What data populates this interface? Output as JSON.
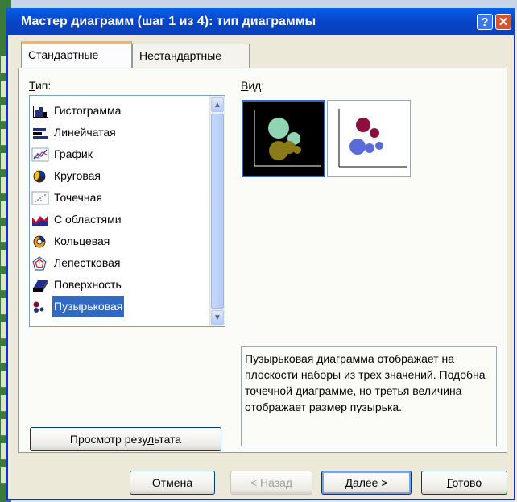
{
  "window": {
    "title": "Мастер диаграмм (шаг 1 из 4): тип диаграммы",
    "help_label": "?",
    "close_label": "✕"
  },
  "tabs": [
    {
      "label": "Стандартные",
      "active": true
    },
    {
      "label": "Нестандартные",
      "active": false
    }
  ],
  "type_label_first": "Т",
  "type_label_rest": "ип:",
  "view_label_first": "В",
  "view_label_rest": "ид:",
  "chart_types": [
    {
      "label": "Гистограмма",
      "icon": "column-chart-icon"
    },
    {
      "label": "Линейчатая",
      "icon": "bar-chart-icon"
    },
    {
      "label": "График",
      "icon": "line-chart-icon"
    },
    {
      "label": "Круговая",
      "icon": "pie-chart-icon"
    },
    {
      "label": "Точечная",
      "icon": "scatter-chart-icon"
    },
    {
      "label": "С областями",
      "icon": "area-chart-icon"
    },
    {
      "label": "Кольцевая",
      "icon": "doughnut-chart-icon"
    },
    {
      "label": "Лепестковая",
      "icon": "radar-chart-icon"
    },
    {
      "label": "Поверхность",
      "icon": "surface-chart-icon"
    },
    {
      "label": "Пузырьковая",
      "icon": "bubble-chart-icon",
      "selected": true
    }
  ],
  "description": "Пузырьковая диаграмма отображает на плоскости наборы из трех значений. Подобна точечной диаграмме, но третья величина отображает размер пузырька.",
  "buttons": {
    "preview_before": "Просмотр резу",
    "preview_underlined": "л",
    "preview_after": "ьтата",
    "cancel": "Отмена",
    "back": "< Назад",
    "next_underlined": "Д",
    "next_rest": "алее >",
    "finish_underlined": "Г",
    "finish_rest": "отово"
  },
  "colors": {
    "selection": "#316ac5",
    "titlebar": "#0a5fe8",
    "active_tab_accent": "#f7b64a"
  }
}
